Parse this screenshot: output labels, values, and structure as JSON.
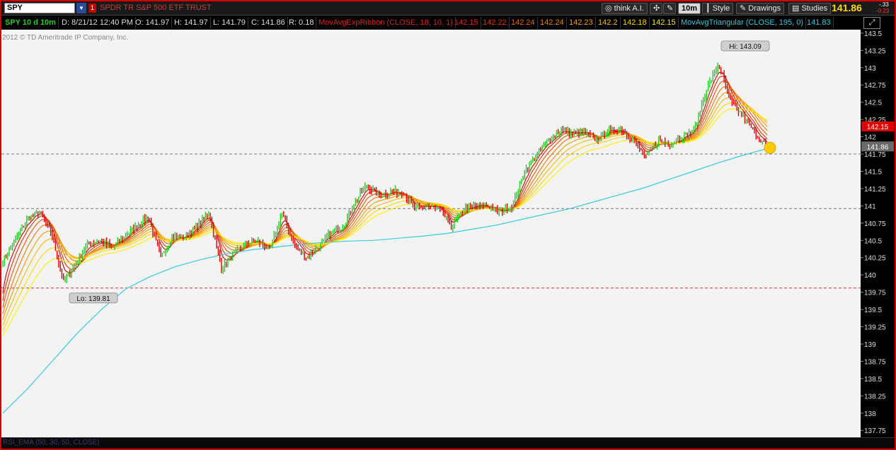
{
  "toolbar": {
    "symbol": "SPY",
    "link_badge": "1",
    "description": "SPDR TR S&P 500 ETF TRUST",
    "think_ai": "think A.I.",
    "timeframe": "10m",
    "style": "Style",
    "drawings": "Drawings",
    "studies": "Studies",
    "last_price": "141.86",
    "net_change": "-.33",
    "pct_change": "-0.23"
  },
  "infobar": {
    "symbol_period": "SPY 10 d 10m",
    "date": "D: 8/21/12 12:40 PM",
    "open": "O: 141.97",
    "high": "H: 141.97",
    "low": "L: 141.79",
    "close": "C: 141.86",
    "range": "R: 0.18",
    "ribbon_study": "MovAvgExpRibbon (CLOSE, 18, 10, 1)",
    "ribbon_values": [
      "142.15",
      "142.22",
      "142.24",
      "142.24",
      "142.23",
      "142.2",
      "142.18",
      "142.15"
    ],
    "triangular_study": "MovAvgTriangular (CLOSE, 195, 0)",
    "triangular_value": "141.83"
  },
  "copyright": "2012 © TD Ameritrade IP Company, Inc.",
  "bottom_strip": "RSI_EMA (50, 30, 50, CLOSE)",
  "colors": {
    "up_bar": "#22cc22",
    "down_bar": "#e00000",
    "triangular": "#33ccdd",
    "ribbon": [
      "#cc0000",
      "#dd3300",
      "#e65500",
      "#ee7700",
      "#f39900",
      "#f7bb00",
      "#fbd800",
      "#ffee00"
    ],
    "price_tag_red": "#e00000",
    "price_tag_gray": "#6a6a6a",
    "marker": "#ffcc00"
  },
  "chart_data": {
    "type": "line",
    "title": "SPY 10 d 10m",
    "ylabel": "",
    "ylim": [
      137.65,
      143.55
    ],
    "y_ticks": [
      "143.5",
      "143.25",
      "143",
      "142.75",
      "142.5",
      "142.25",
      "142",
      "141.75",
      "141.5",
      "141.25",
      "141",
      "140.75",
      "140.5",
      "140.25",
      "140",
      "139.75",
      "139.5",
      "139.25",
      "139",
      "138.75",
      "138.5",
      "138.25",
      "138",
      "137.75"
    ],
    "hi_label": "Hi: 143.09",
    "lo_label": "Lo: 139.81",
    "hi": 143.09,
    "lo": 139.81,
    "reference_lines": [
      141.75,
      140.96,
      139.81
    ],
    "price_tags": [
      {
        "value": 142.15,
        "label": "142.15",
        "kind": "red"
      },
      {
        "value": 141.86,
        "label": "141.86",
        "kind": "gray"
      }
    ],
    "series": [
      {
        "name": "SPY Close",
        "values": [
          140.2,
          140.5,
          140.8,
          140.92,
          140.6,
          139.9,
          140.15,
          140.45,
          140.5,
          140.4,
          140.55,
          140.7,
          140.85,
          140.25,
          140.55,
          140.55,
          140.7,
          140.9,
          140.1,
          140.3,
          140.45,
          140.5,
          140.35,
          140.9,
          140.45,
          140.25,
          140.4,
          140.6,
          140.7,
          141.05,
          141.3,
          141.15,
          141.2,
          141.2,
          140.95,
          141.0,
          140.95,
          140.7,
          140.95,
          141.0,
          141.0,
          140.9,
          141.0,
          141.5,
          141.75,
          141.95,
          142.1,
          142.05,
          142.05,
          141.95,
          142.1,
          142.1,
          141.95,
          141.7,
          141.95,
          141.9,
          142.0,
          142.1,
          142.7,
          143.05,
          142.5,
          142.3,
          142.05,
          141.86
        ]
      },
      {
        "name": "MovAvgTriangular",
        "values": [
          138.0,
          138.35,
          138.75,
          139.15,
          139.5,
          139.8,
          139.98,
          140.12,
          140.22,
          140.3,
          140.36,
          140.4,
          140.44,
          140.47,
          140.49,
          140.5,
          140.53,
          140.56,
          140.6,
          140.66,
          140.72,
          140.8,
          140.88,
          140.96,
          141.06,
          141.16,
          141.26,
          141.38,
          141.5,
          141.62,
          141.73,
          141.83
        ]
      }
    ],
    "ribbon_last": [
      142.15,
      142.22,
      142.24,
      142.24,
      142.23,
      142.2,
      142.18,
      142.15
    ]
  }
}
